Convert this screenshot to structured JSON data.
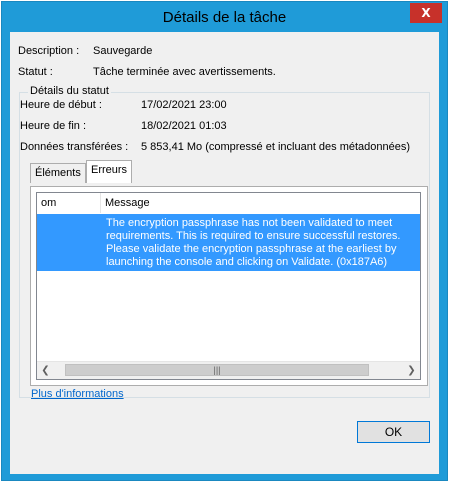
{
  "window": {
    "title": "Détails de la tâche",
    "close_glyph": "X"
  },
  "summary": {
    "description_label": "Description :",
    "description_value": "Sauvegarde",
    "status_label": "Statut :",
    "status_value": "Tâche terminée avec avertissements."
  },
  "status_details": {
    "group_title": "Détails du statut",
    "start_label": "Heure de début :",
    "start_value": "17/02/2021 23:00",
    "end_label": "Heure de fin :",
    "end_value": "18/02/2021 01:03",
    "data_label": "Données transférées :",
    "data_value": "5 853,41 Mo (compressé et incluant des métadonnées)"
  },
  "tabs": [
    {
      "label": "Éléments"
    },
    {
      "label": "Erreurs"
    }
  ],
  "errors_table": {
    "columns": [
      "om",
      "Message"
    ],
    "rows": [
      {
        "name": "",
        "message": "The encryption passphrase has not been validated to meet requirements. This is required to ensure successful restores. Please validate the encryption passphrase at the earliest by launching the console and clicking on Validate. (0x187A6)"
      }
    ]
  },
  "more_info_link": "Plus d'informations",
  "ok_label": "OK"
}
